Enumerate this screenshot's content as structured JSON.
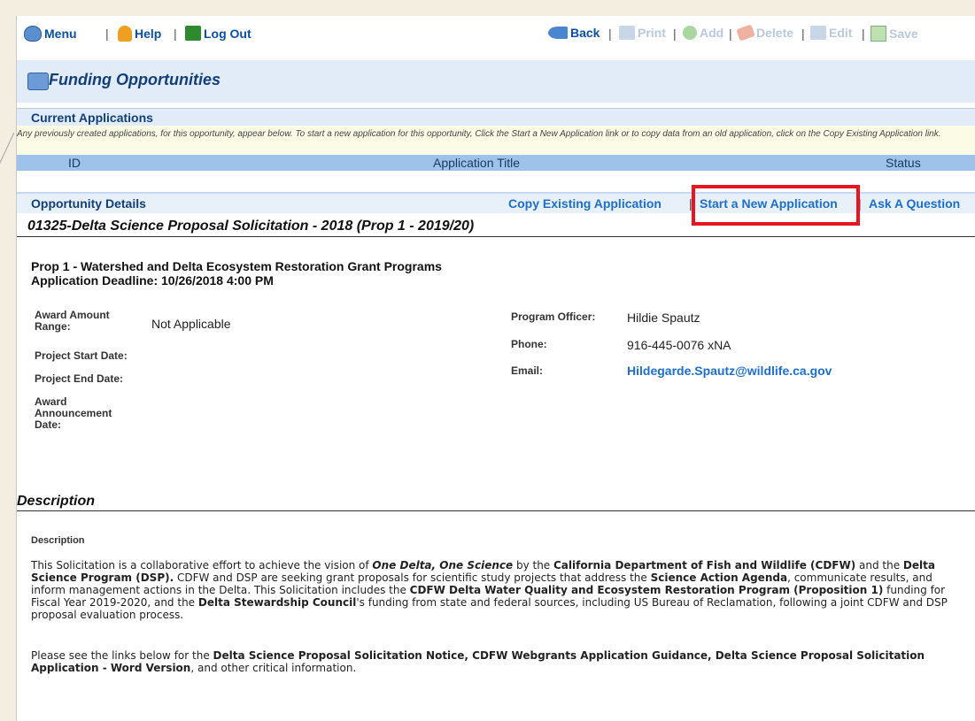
{
  "toolbar": {
    "menu": "Menu",
    "help": "Help",
    "logout": "Log Out",
    "back": "Back",
    "print": "Print",
    "add": "Add",
    "delete": "Delete",
    "edit": "Edit",
    "save": "Save",
    "sep": "|"
  },
  "header": {
    "title": "Funding Opportunities"
  },
  "current_applications": {
    "title": "Current Applications",
    "note": "Any previously created applications, for this opportunity, appear below. To start a new application for this opportunity, Click the Start a New Application link or to copy data from an old application, click on the Copy Existing Application link.",
    "columns": [
      "ID",
      "Application Title",
      "Status"
    ]
  },
  "opportunity": {
    "section_label": "Opportunity Details",
    "links": {
      "copy": "Copy Existing Application",
      "start_new": "Start a New Application",
      "ask": "Ask A Question"
    },
    "solicitation_title": "01325-Delta Science Proposal Solicitation - 2018 (Prop 1 - 2019/20)",
    "program": "Prop 1 - Watershed and Delta Ecosystem Restoration Grant Programs",
    "deadline": "Application Deadline: 10/26/2018 4:00 PM",
    "award_amount_label": "Award Amount Range:",
    "award_amount_value": "Not Applicable",
    "project_start_label": "Project Start Date:",
    "project_end_label": "Project End Date:",
    "award_announcement_label": "Award Announcement Date:",
    "program_officer_label": "Program Officer:",
    "program_officer_value": "Hildie Spautz",
    "phone_label": "Phone:",
    "phone_value": "916-445-0076 xNA",
    "email_label": "Email:",
    "email_value": "Hildegarde.Spautz@wildlife.ca.gov"
  },
  "description": {
    "heading": "Description",
    "subheading": "Description",
    "p1": {
      "t1": "This Solicitation is a collaborative effort to achieve the vision of ",
      "b1": "One Delta, One Science",
      "t2": " by the ",
      "b2": "California Department of Fish and Wildlife (CDFW)",
      "t3": " and the ",
      "b3": "Delta Science Program (DSP).",
      "t4": " CDFW and DSP are seeking grant proposals for scientific study projects that address the ",
      "b4": "Science Action Agenda",
      "t5": ", communicate results, and inform management actions in the Delta. This Solicitation includes the ",
      "b5": "CDFW Delta Water Quality and Ecosystem Restoration Program (Proposition 1)",
      "t6": " funding for Fiscal Year 2019-2020, and the ",
      "b6": "Delta Stewardship Council",
      "t7": "'s funding from state and federal sources, including US Bureau of Reclamation, following a joint CDFW and DSP proposal evaluation process."
    },
    "p2": {
      "t1": "Please see the links below for the ",
      "b1": "Delta Science Proposal Solicitation Notice, CDFW Webgrants Application Guidance, Delta Science Proposal Solicitation Application - Word Version",
      "t2": ", and other critical information."
    }
  }
}
